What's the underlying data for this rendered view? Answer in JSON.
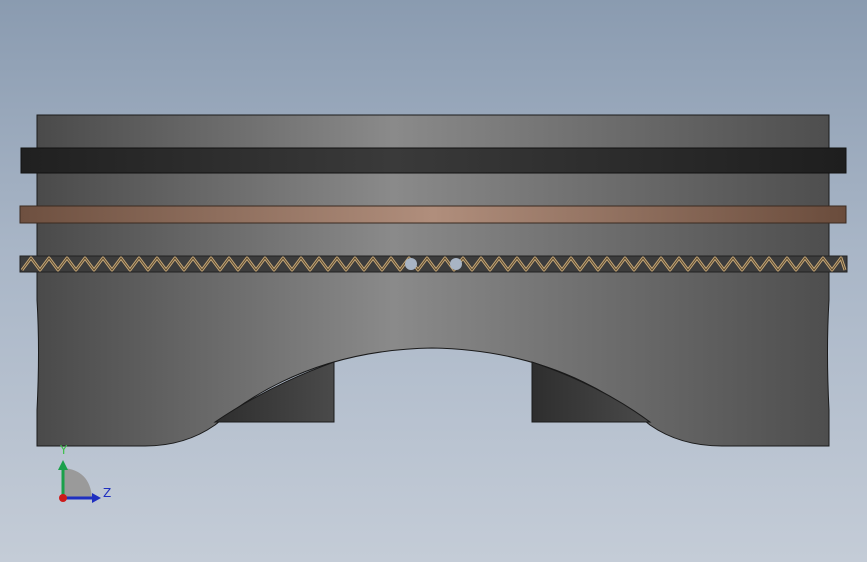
{
  "viewport": {
    "background_top": "#8a9bb0",
    "background_bottom": "#c4ccd7",
    "model": "piston",
    "view": "side-view"
  },
  "piston": {
    "body_color_dark": "#4e4e4e",
    "body_color_light": "#8c8c8c",
    "top_ring_color": "#262626",
    "second_ring_color": "#a48270",
    "oil_ring_color": "#c8a878",
    "pin_boss_color": "#3a3a3a"
  },
  "triad": {
    "y_label": "Y",
    "z_label": "Z",
    "y_color": "#1aa04a",
    "z_color": "#1f2fc0",
    "x_color": "#cc1a1a",
    "label_y_color": "#3cc04a",
    "label_z_color": "#1f2fc0"
  }
}
